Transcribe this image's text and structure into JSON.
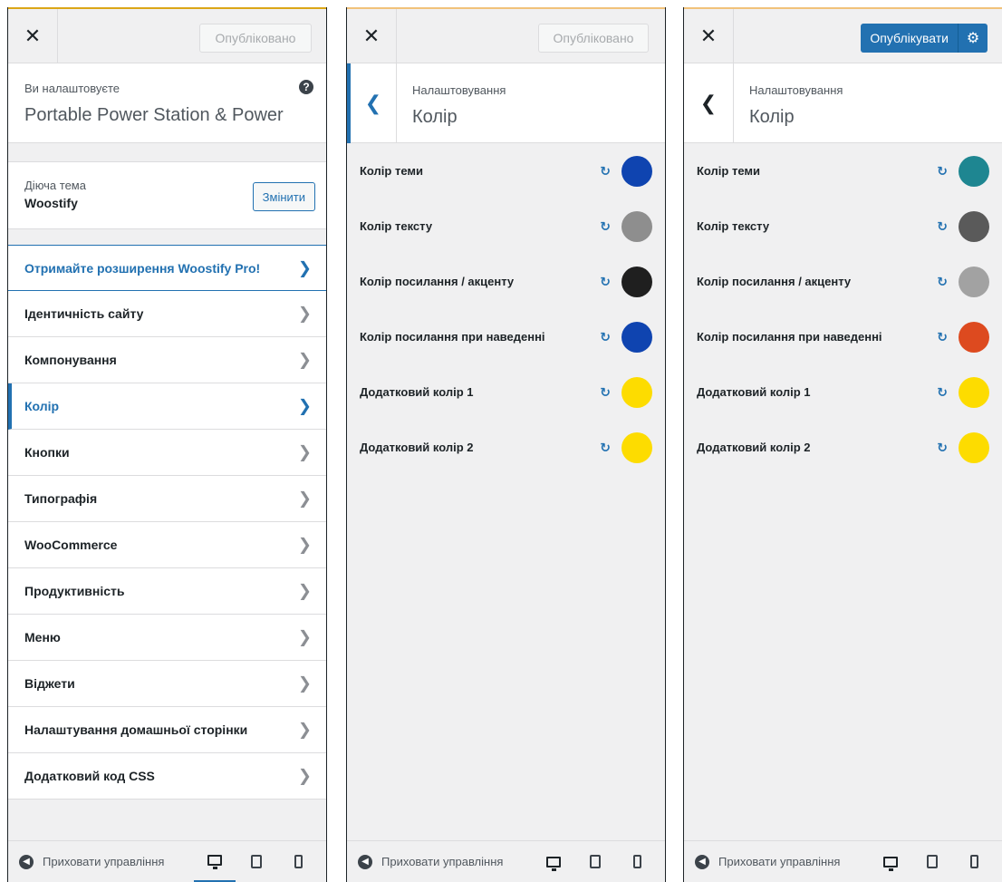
{
  "panel1": {
    "publish_label": "Опубліковано",
    "customizing_label": "Ви налаштовуєте",
    "site_title": "Portable Power Station & Power",
    "active_theme_label": "Діюча тема",
    "theme_name": "Woostify",
    "change_label": "Змінити",
    "pro_link": "Отримайте розширення Woostify Pro!",
    "menu": [
      {
        "label": "Ідентичність сайту",
        "active": false
      },
      {
        "label": "Компонування",
        "active": false
      },
      {
        "label": "Колір",
        "active": true
      },
      {
        "label": "Кнопки",
        "active": false
      },
      {
        "label": "Типографія",
        "active": false
      },
      {
        "label": "WooCommerce",
        "active": false
      },
      {
        "label": "Продуктивність",
        "active": false
      },
      {
        "label": "Меню",
        "active": false
      },
      {
        "label": "Віджети",
        "active": false
      },
      {
        "label": "Налаштування домашньої сторінки",
        "active": false
      },
      {
        "label": "Додатковий код CSS",
        "active": false
      }
    ]
  },
  "panel2": {
    "publish_label": "Опубліковано",
    "breadcrumb": "Налаштовування",
    "section_title": "Колір",
    "colors": [
      {
        "label": "Колір теми",
        "color": "#0f44b0"
      },
      {
        "label": "Колір тексту",
        "color": "#8e8e8e"
      },
      {
        "label": "Колір посилання / акценту",
        "color": "#1f1f1f"
      },
      {
        "label": "Колір посилання при наведенні",
        "color": "#0f44b0"
      },
      {
        "label": "Додатковий колір 1",
        "color": "#fddc00"
      },
      {
        "label": "Додатковий колір 2",
        "color": "#fddc00"
      }
    ]
  },
  "panel3": {
    "publish_label": "Опублікувати",
    "breadcrumb": "Налаштовування",
    "section_title": "Колір",
    "colors": [
      {
        "label": "Колір теми",
        "color": "#1e8691"
      },
      {
        "label": "Колір тексту",
        "color": "#5a5a5a"
      },
      {
        "label": "Колір посилання / акценту",
        "color": "#a2a2a2"
      },
      {
        "label": "Колір посилання при наведенні",
        "color": "#dd4a1f"
      },
      {
        "label": "Додатковий колір 1",
        "color": "#fddc00"
      },
      {
        "label": "Додатковий колір 2",
        "color": "#fddc00"
      }
    ]
  },
  "footer": {
    "hide_controls_label": "Приховати управління"
  },
  "icons": {
    "close": "close-icon",
    "help": "help-icon",
    "chevron": "chevron-right-icon",
    "back": "chevron-left-icon",
    "reset": "reset-icon",
    "gear": "gear-icon",
    "desktop": "desktop-icon",
    "tablet": "tablet-icon",
    "mobile": "mobile-icon"
  }
}
